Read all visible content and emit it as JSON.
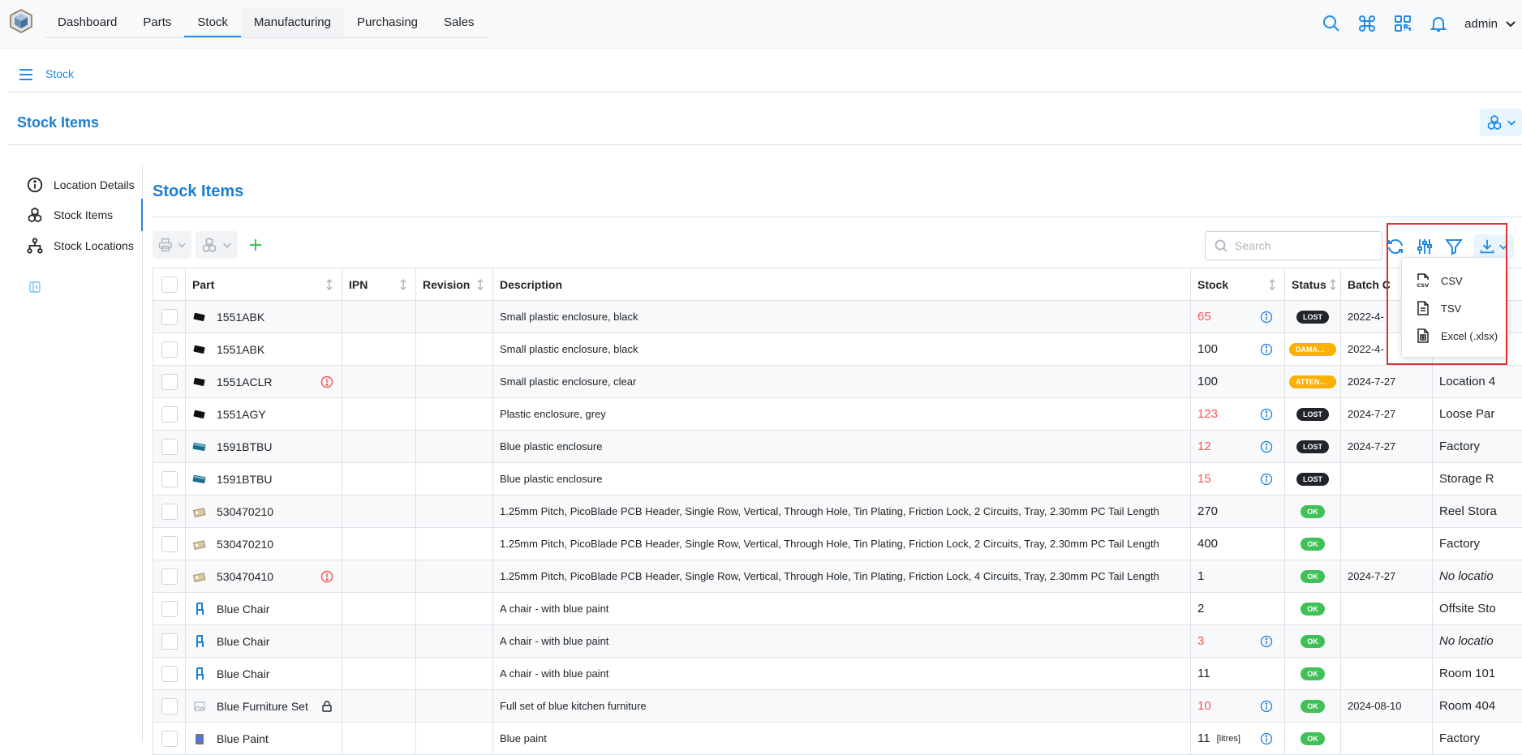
{
  "header": {
    "tabs": [
      "Dashboard",
      "Parts",
      "Stock",
      "Manufacturing",
      "Purchasing",
      "Sales"
    ],
    "active_tab": "Stock",
    "user": "admin"
  },
  "breadcrumb": {
    "item": "Stock"
  },
  "page": {
    "title": "Stock Items"
  },
  "side": {
    "items": [
      "Location Details",
      "Stock Items",
      "Stock Locations"
    ]
  },
  "main": {
    "title": "Stock Items",
    "search_placeholder": "Search"
  },
  "table": {
    "columns": [
      "Part",
      "IPN",
      "Revision",
      "Description",
      "Stock",
      "Status",
      "Batch C"
    ],
    "rows": [
      {
        "part": "1551ABK",
        "description": "Small plastic enclosure, black",
        "stock": "65",
        "stock_red": true,
        "unit": "",
        "info": true,
        "status": "LOST",
        "status_kind": "lost",
        "batch": "2022-4-",
        "location": "",
        "warn": false,
        "lock": false,
        "thumb": "black-box"
      },
      {
        "part": "1551ABK",
        "description": "Small plastic enclosure, black",
        "stock": "100",
        "stock_red": false,
        "unit": "",
        "info": true,
        "status": "DAMAGED",
        "status_kind": "warn",
        "batch": "2022-4-",
        "location": "",
        "warn": false,
        "lock": false,
        "thumb": "black-box"
      },
      {
        "part": "1551ACLR",
        "description": "Small plastic enclosure, clear",
        "stock": "100",
        "stock_red": false,
        "unit": "",
        "info": false,
        "status": "ATTENTION",
        "status_kind": "warn",
        "batch": "2024-7-27",
        "location": "Location 4",
        "warn": true,
        "lock": false,
        "thumb": "black-box"
      },
      {
        "part": "1551AGY",
        "description": "Plastic enclosure, grey",
        "stock": "123",
        "stock_red": true,
        "unit": "",
        "info": true,
        "status": "LOST",
        "status_kind": "lost",
        "batch": "2024-7-27",
        "location": "Loose Par",
        "warn": false,
        "lock": false,
        "thumb": "black-box"
      },
      {
        "part": "1591BTBU",
        "description": "Blue plastic enclosure",
        "stock": "12",
        "stock_red": true,
        "unit": "",
        "info": true,
        "status": "LOST",
        "status_kind": "lost",
        "batch": "2024-7-27",
        "location": "Factory",
        "warn": false,
        "lock": false,
        "thumb": "teal-box"
      },
      {
        "part": "1591BTBU",
        "description": "Blue plastic enclosure",
        "stock": "15",
        "stock_red": true,
        "unit": "",
        "info": true,
        "status": "LOST",
        "status_kind": "lost",
        "batch": "",
        "location": "Storage R",
        "warn": false,
        "lock": false,
        "thumb": "teal-box"
      },
      {
        "part": "530470210",
        "description": "1.25mm Pitch, PicoBlade PCB Header, Single Row, Vertical, Through Hole, Tin Plating, Friction Lock, 2 Circuits, Tray, 2.30mm PC Tail Length",
        "stock": "270",
        "stock_red": false,
        "unit": "",
        "info": false,
        "status": "OK",
        "status_kind": "ok",
        "batch": "",
        "location": "Reel Stora",
        "warn": false,
        "lock": false,
        "thumb": "header"
      },
      {
        "part": "530470210",
        "description": "1.25mm Pitch, PicoBlade PCB Header, Single Row, Vertical, Through Hole, Tin Plating, Friction Lock, 2 Circuits, Tray, 2.30mm PC Tail Length",
        "stock": "400",
        "stock_red": false,
        "unit": "",
        "info": false,
        "status": "OK",
        "status_kind": "ok",
        "batch": "",
        "location": "Factory",
        "warn": false,
        "lock": false,
        "thumb": "header"
      },
      {
        "part": "530470410",
        "description": "1.25mm Pitch, PicoBlade PCB Header, Single Row, Vertical, Through Hole, Tin Plating, Friction Lock, 4 Circuits, Tray, 2.30mm PC Tail Length",
        "stock": "1",
        "stock_red": false,
        "unit": "",
        "info": false,
        "status": "OK",
        "status_kind": "ok",
        "batch": "2024-7-27",
        "location": "No locatio",
        "location_italic": true,
        "warn": true,
        "lock": false,
        "thumb": "header"
      },
      {
        "part": "Blue Chair",
        "description": "A chair - with blue paint",
        "stock": "2",
        "stock_red": false,
        "unit": "",
        "info": false,
        "status": "OK",
        "status_kind": "ok",
        "batch": "",
        "location": "Offsite Sto",
        "warn": false,
        "lock": false,
        "thumb": "chair"
      },
      {
        "part": "Blue Chair",
        "description": "A chair - with blue paint",
        "stock": "3",
        "stock_red": true,
        "unit": "",
        "info": true,
        "status": "OK",
        "status_kind": "ok",
        "batch": "",
        "location": "No locatio",
        "location_italic": true,
        "warn": false,
        "lock": false,
        "thumb": "chair"
      },
      {
        "part": "Blue Chair",
        "description": "A chair - with blue paint",
        "stock": "11",
        "stock_red": false,
        "unit": "",
        "info": false,
        "status": "OK",
        "status_kind": "ok",
        "batch": "",
        "location": "Room 101",
        "warn": false,
        "lock": false,
        "thumb": "chair"
      },
      {
        "part": "Blue Furniture Set",
        "description": "Full set of blue kitchen furniture",
        "stock": "10",
        "stock_red": true,
        "unit": "",
        "info": true,
        "status": "OK",
        "status_kind": "ok",
        "batch": "2024-08-10",
        "location": "Room 404",
        "warn": false,
        "lock": true,
        "thumb": "image"
      },
      {
        "part": "Blue Paint",
        "description": "Blue paint",
        "stock": "11",
        "stock_red": false,
        "unit": "[litres]",
        "info": true,
        "status": "OK",
        "status_kind": "ok",
        "batch": "",
        "location": "Factory",
        "warn": false,
        "lock": false,
        "thumb": "paint"
      }
    ]
  },
  "download_menu": {
    "items": [
      "CSV",
      "TSV",
      "Excel (.xlsx)"
    ]
  },
  "colors": {
    "accent": "#228be6",
    "title": "#1c7ed6",
    "danger": "#fa5252",
    "ok": "#40c057",
    "warning": "#fab005",
    "highlight": "#e03131"
  }
}
